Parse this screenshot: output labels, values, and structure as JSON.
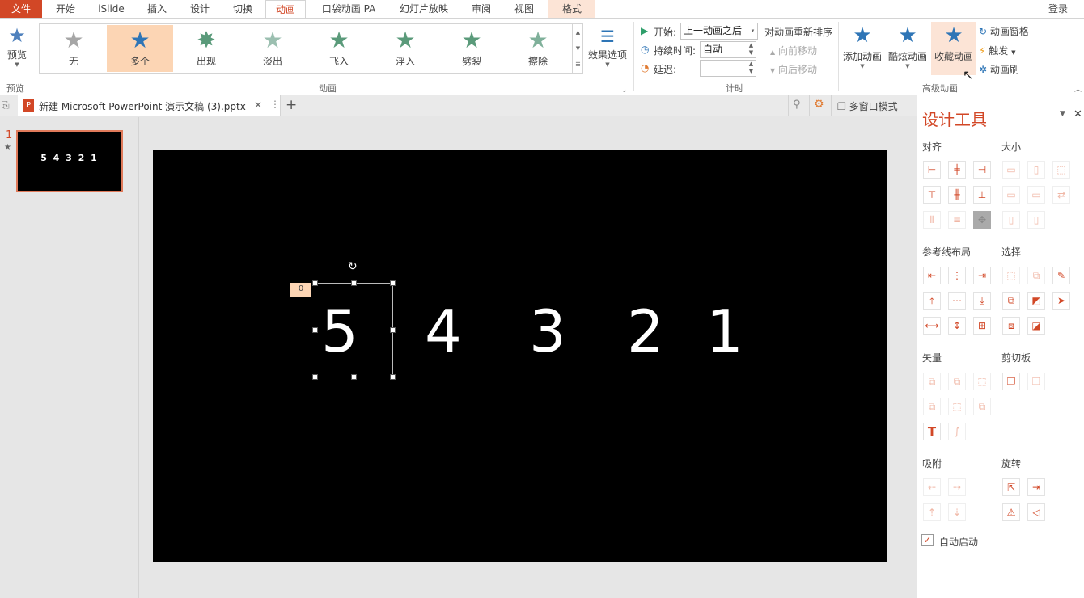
{
  "tabs": {
    "file": "文件",
    "home": "开始",
    "islide": "iSlide",
    "insert": "插入",
    "design": "设计",
    "transition": "切换",
    "animation": "动画",
    "pocket": "口袋动画 PA",
    "slideshow": "幻灯片放映",
    "review": "审阅",
    "view": "视图",
    "format": "格式",
    "login": "登录"
  },
  "ribbon": {
    "preview": {
      "label": "预览",
      "group": "预览"
    },
    "gallery": {
      "items": [
        "无",
        "多个",
        "出现",
        "淡出",
        "飞入",
        "浮入",
        "劈裂",
        "擦除"
      ],
      "selected": "多个",
      "group": "动画"
    },
    "effect_options": "效果选项",
    "timing": {
      "start_label": "开始:",
      "start_value": "上一动画之后",
      "duration_label": "持续时间:",
      "duration_value": "自动",
      "delay_label": "延迟:",
      "delay_value": "",
      "reorder_title": "对动画重新排序",
      "move_earlier": "向前移动",
      "move_later": "向后移动",
      "group": "计时"
    },
    "advanced": {
      "add_animation": "添加动画",
      "cool_animation": "酷炫动画",
      "fav_animation": "收藏动画",
      "animation_pane": "动画窗格",
      "trigger": "触发",
      "animation_painter": "动画刷",
      "group": "高级动画"
    }
  },
  "docbar": {
    "filename": "新建 Microsoft PowerPoint 演示文稿 (3).pptx",
    "close": "✕",
    "new_tab": "+",
    "multi_window": "多窗口模式"
  },
  "thumbnail": {
    "number": "1",
    "star": "★",
    "text": "5 4 3 2 1"
  },
  "slide": {
    "numbers": [
      "5",
      "4",
      "3",
      "2",
      "1"
    ],
    "animation_tag": "0"
  },
  "pane": {
    "title": "设计工具",
    "sections": {
      "align": "对齐",
      "size": "大小",
      "guides": "参考线布局",
      "select": "选择",
      "vector": "矢量",
      "clipboard": "剪切板",
      "snap": "吸附",
      "rotate": "旋转"
    },
    "auto_start": "自动启动",
    "auto_start_checked": true
  },
  "colors": {
    "accent": "#d24726",
    "selected_bg": "#fcd5b4",
    "star_blue": "#4f81bd"
  }
}
